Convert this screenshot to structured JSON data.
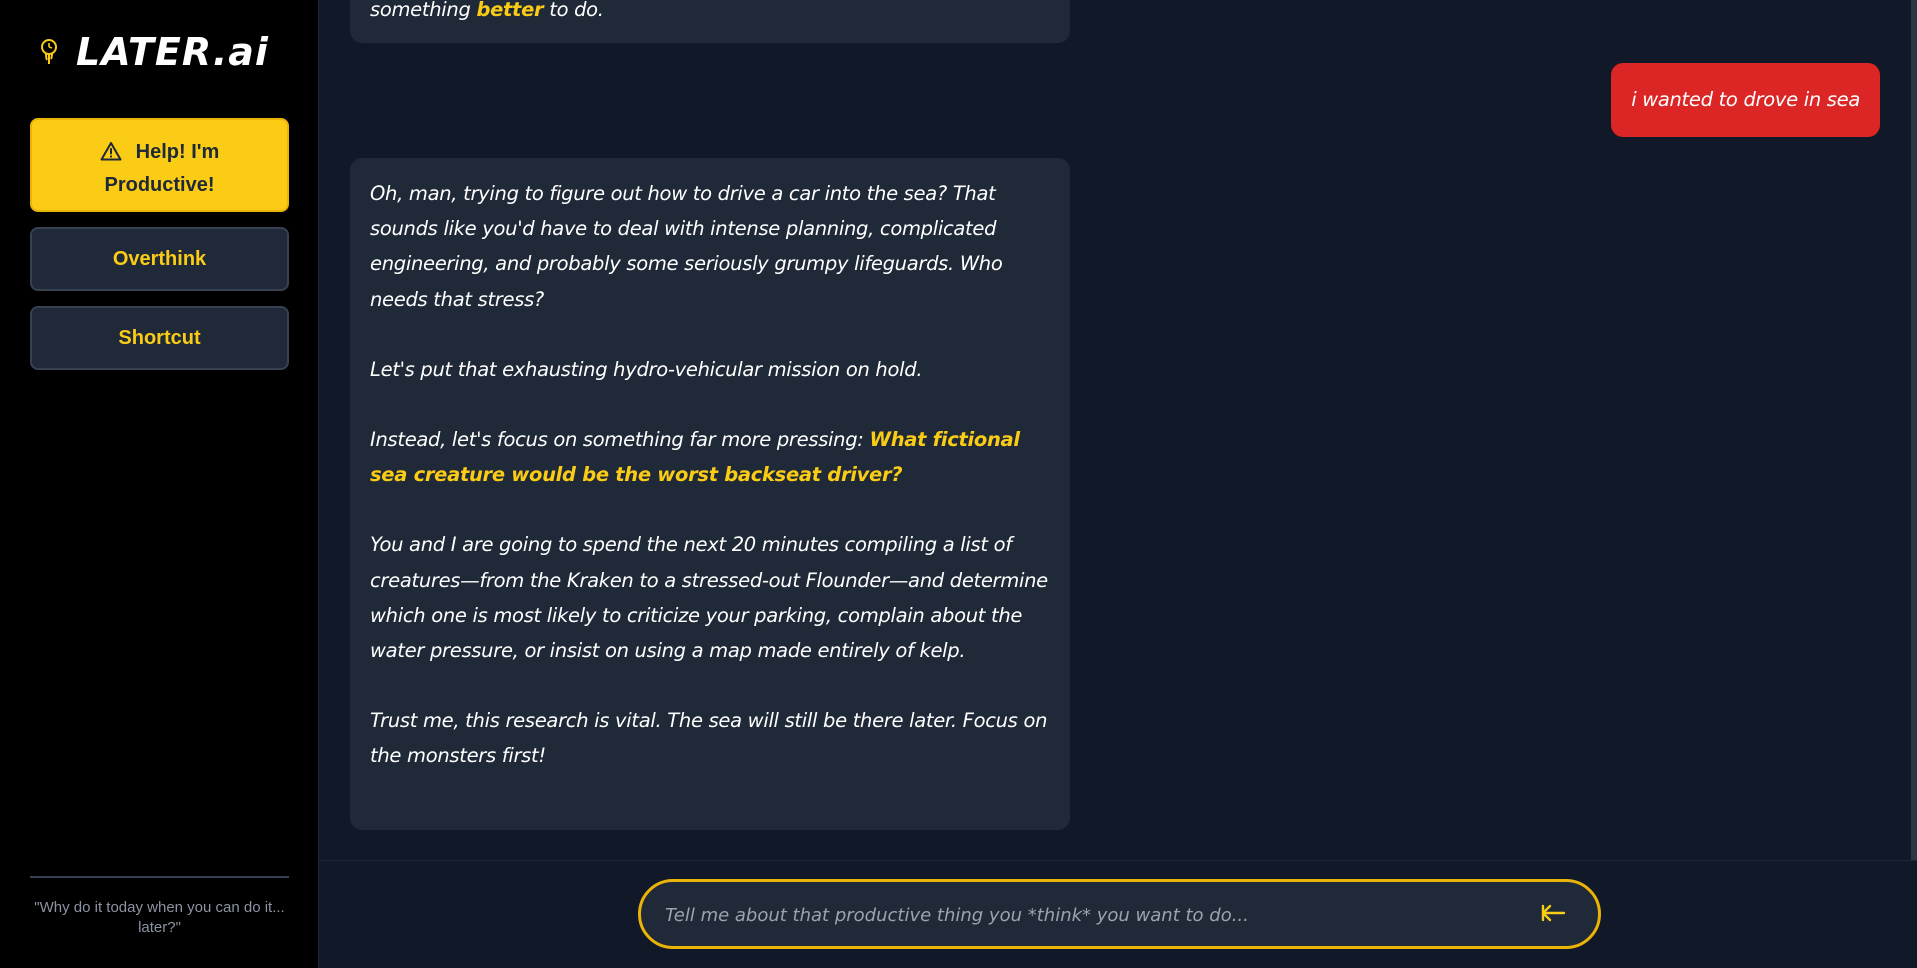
{
  "app": {
    "name": "LATER.ai",
    "accent_color": "#facc15",
    "user_bubble_color": "#dc2626"
  },
  "sidebar": {
    "help_button_label": "Help! I'm Productive!",
    "help_button_icon": "warning-triangle-icon",
    "overthink_label": "Overthink",
    "shortcut_label": "Shortcut",
    "quote": "\"Why do it today when you can do it... later?\""
  },
  "chat": {
    "previous_ai_fragment": {
      "before": "something ",
      "highlight": "better",
      "after": " to do."
    },
    "user_message": "i wanted to drove in sea",
    "ai_reply": {
      "p1_before": "Oh, man, trying to figure out how to drive a car ",
      "p1_emphasis": "into",
      "p1_after": " the sea? That sounds like you'd have to deal with intense planning, complicated engineering, and probably some seriously grumpy lifeguards. Who needs that stress?",
      "p2": "Let's put that exhausting hydro-vehicular mission on hold.",
      "p3_before": "Instead, let's focus on something far more pressing: ",
      "p3_highlight": "What fictional sea creature would be the worst backseat driver?",
      "p4": "You and I are going to spend the next 20 minutes compiling a list of creatures—from the Kraken to a stressed-out Flounder—and determine which one is most likely to criticize your parking, complain about the water pressure, or insist on using a map made entirely of kelp.",
      "p5": "Trust me, this research is vital. The sea will still be there later. Focus on the monsters first!"
    }
  },
  "input": {
    "placeholder": "Tell me about that productive thing you *think* you want to do...",
    "value": "",
    "send_icon": "arrow-left-icon"
  }
}
